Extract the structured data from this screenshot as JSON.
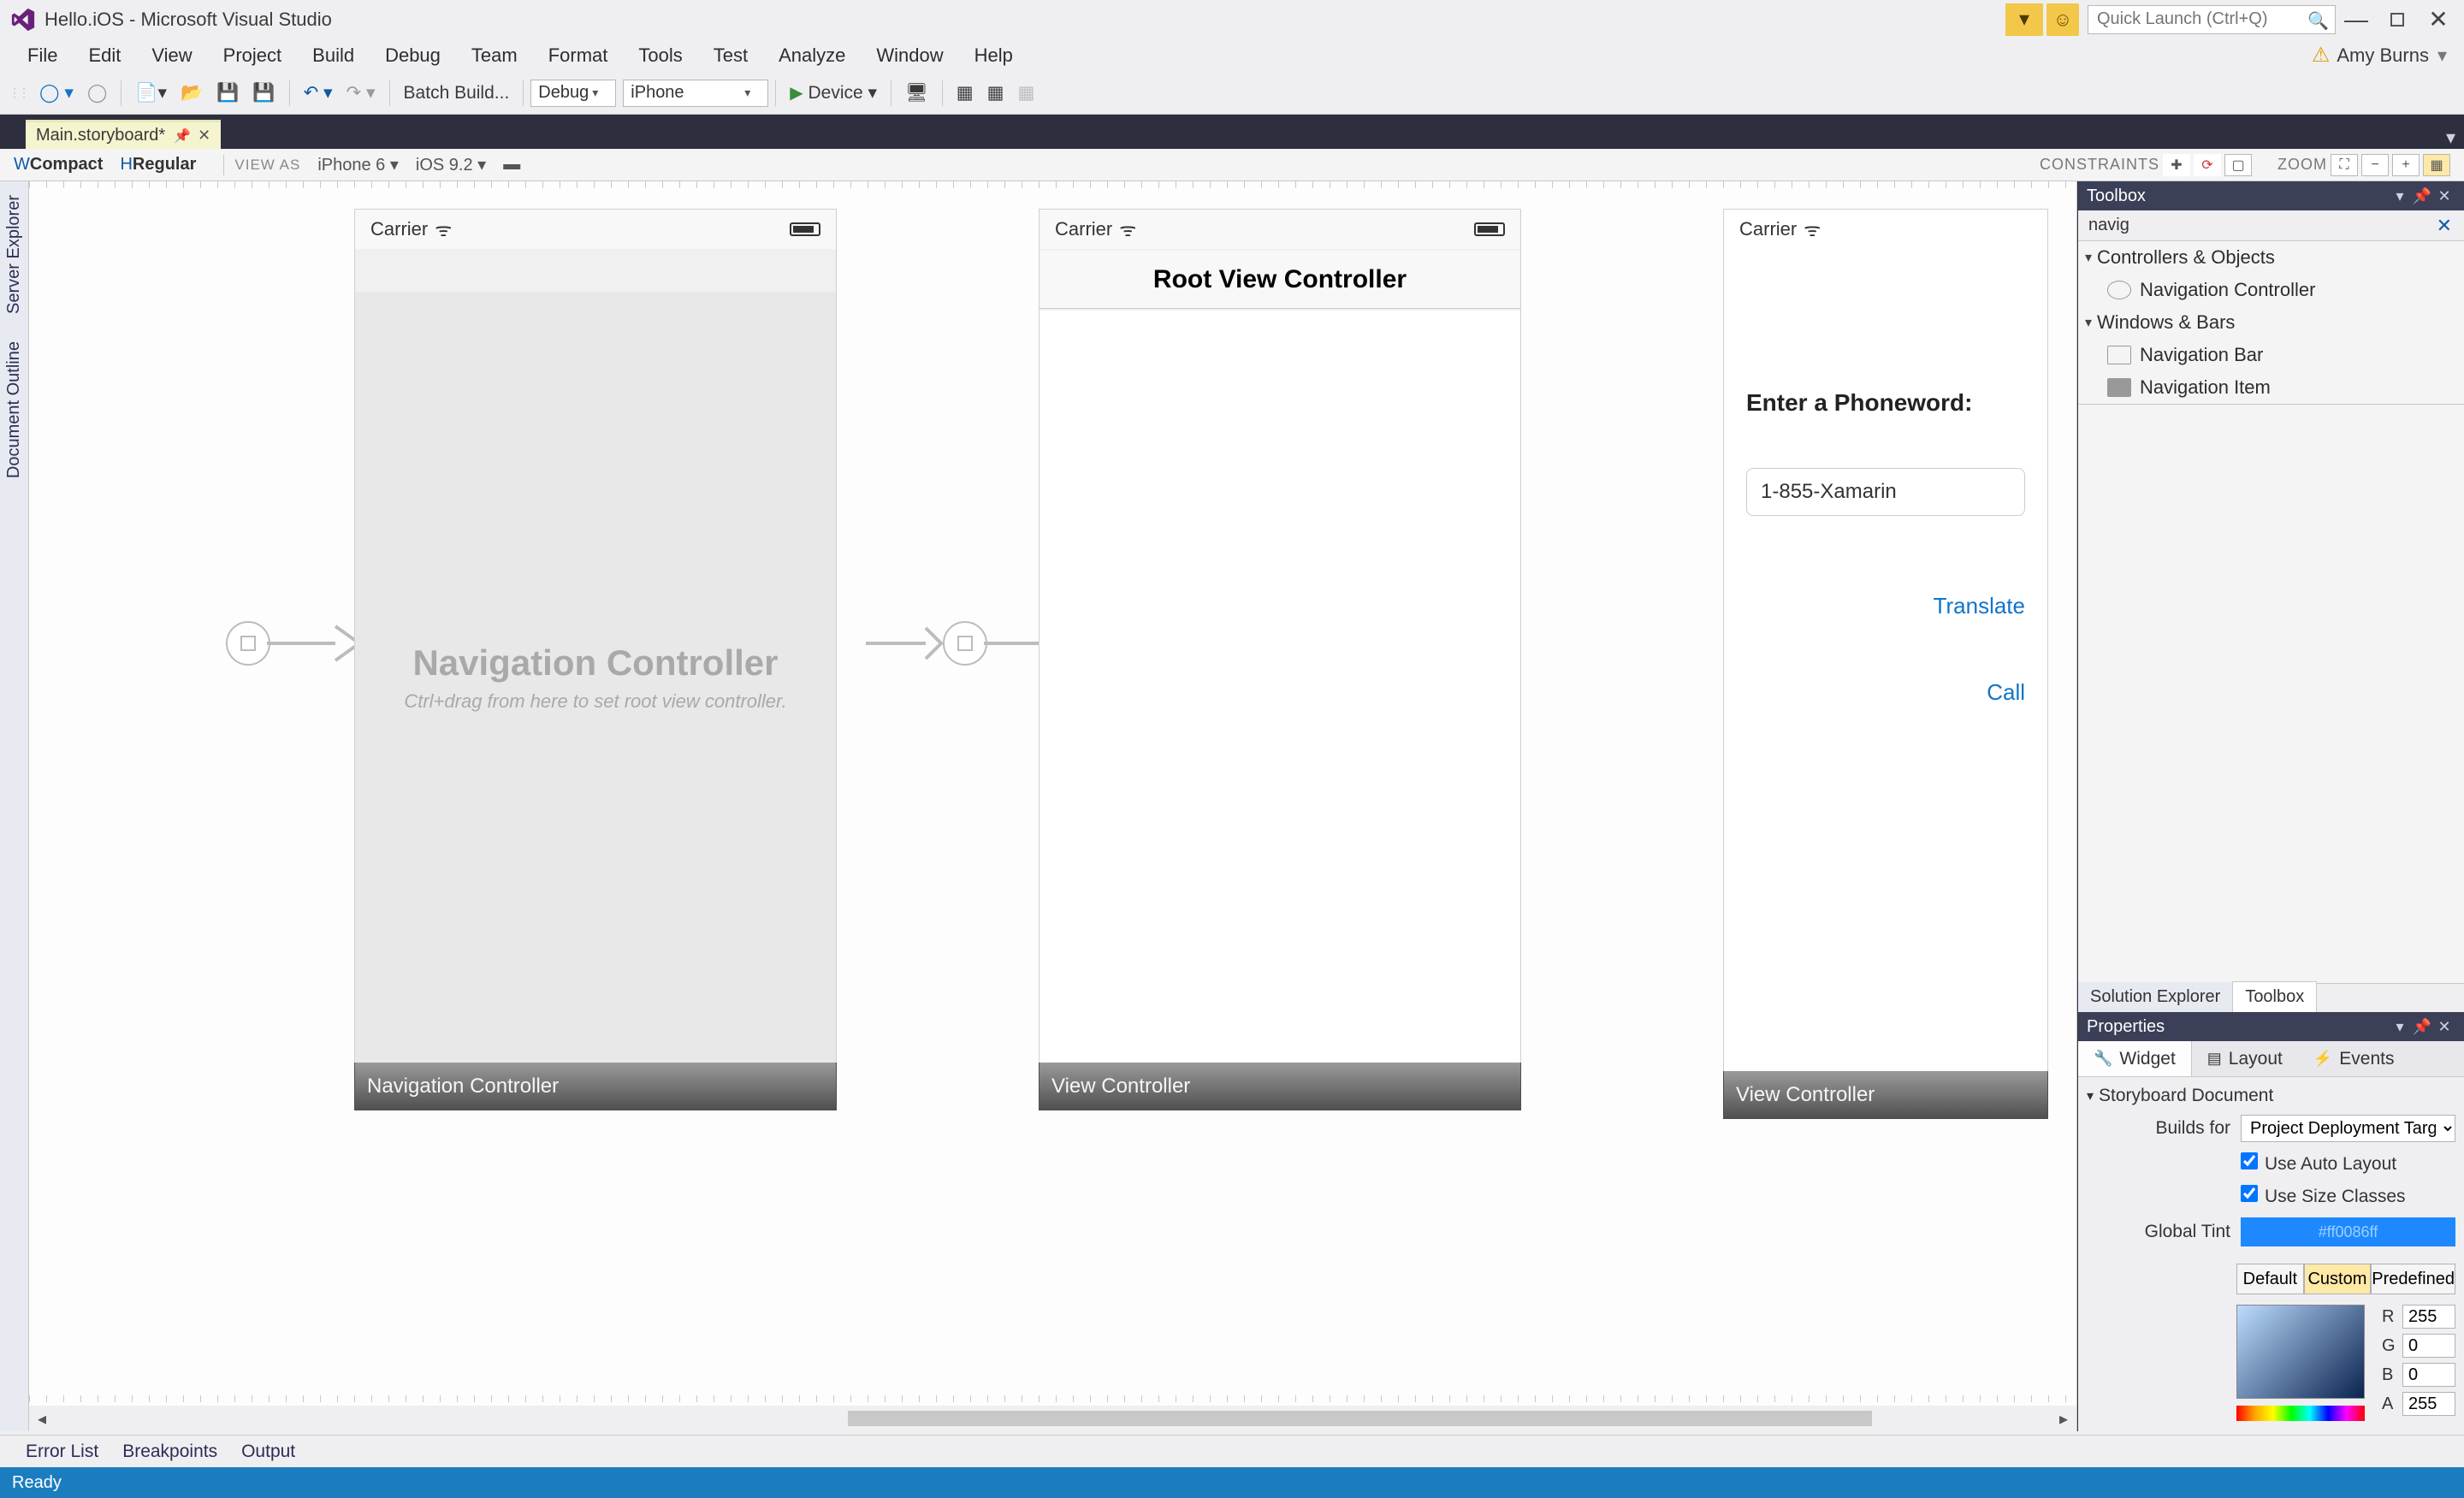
{
  "title": "Hello.iOS - Microsoft Visual Studio",
  "quicklaunch_placeholder": "Quick Launch (Ctrl+Q)",
  "user": "Amy Burns",
  "menu": [
    "File",
    "Edit",
    "View",
    "Project",
    "Build",
    "Debug",
    "Team",
    "Format",
    "Tools",
    "Test",
    "Analyze",
    "Window",
    "Help"
  ],
  "toolbar": {
    "batch": "Batch Build...",
    "config": "Debug",
    "platform": "iPhone",
    "device": "Device"
  },
  "doc_tab": "Main.storyboard*",
  "designer": {
    "w": "Compact",
    "h": "Regular",
    "viewas_label": "VIEW AS",
    "device": "iPhone 6",
    "ios": "iOS 9.2",
    "constraints": "CONSTRAINTS",
    "zoom": "ZOOM"
  },
  "left_tabs": [
    "Server Explorer",
    "Document Outline"
  ],
  "scenes": {
    "nav": {
      "carrier": "Carrier",
      "title": "Navigation Controller",
      "hint": "Ctrl+drag from here to set root view controller.",
      "footer": "Navigation Controller"
    },
    "root": {
      "carrier": "Carrier",
      "navtitle": "Root View Controller",
      "footer": "View Controller"
    },
    "vc2": {
      "carrier": "Carrier",
      "label": "Enter a Phoneword:",
      "value": "1-855-Xamarin",
      "translate": "Translate",
      "call": "Call",
      "footer": "View Controller"
    }
  },
  "toolbox": {
    "title": "Toolbox",
    "search": "navig",
    "groups": [
      {
        "name": "Controllers & Objects",
        "items": [
          {
            "name": "Navigation Controller",
            "kind": "navctrl"
          }
        ]
      },
      {
        "name": "Windows & Bars",
        "items": [
          {
            "name": "Navigation Bar",
            "kind": "bar"
          },
          {
            "name": "Navigation Item",
            "kind": "navitem"
          }
        ]
      }
    ],
    "bottom_tabs": {
      "se": "Solution Explorer",
      "tb": "Toolbox"
    }
  },
  "properties": {
    "title": "Properties",
    "tabs": {
      "widget": "Widget",
      "layout": "Layout",
      "events": "Events"
    },
    "section": "Storyboard Document",
    "builds_label": "Builds for",
    "builds_value": "Project Deployment Target",
    "auto_layout": "Use Auto Layout",
    "size_classes": "Use Size Classes",
    "global_tint": "Global Tint",
    "tint_value": "#ff0086ff",
    "seg": {
      "default": "Default",
      "custom": "Custom",
      "predef": "Predefined"
    },
    "rgba": {
      "r": "255",
      "g": "0",
      "b": "0",
      "a": "255"
    }
  },
  "bottom_tabs": [
    "Error List",
    "Breakpoints",
    "Output"
  ],
  "status": "Ready"
}
